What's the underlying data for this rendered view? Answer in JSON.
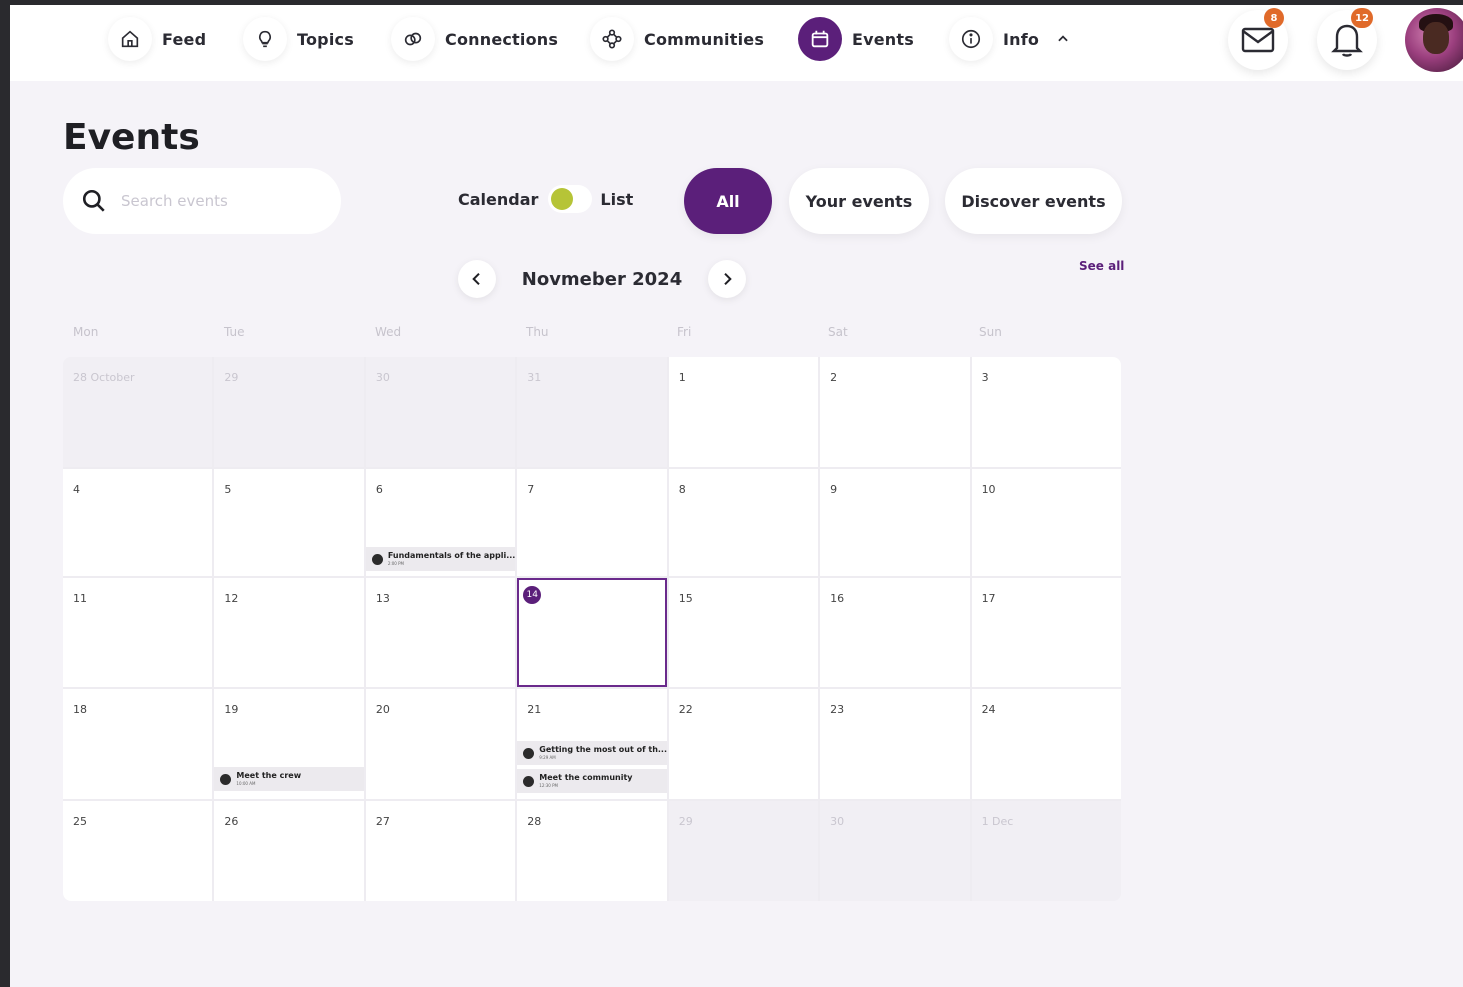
{
  "nav": {
    "items": [
      {
        "label": "Feed",
        "icon": "home-icon"
      },
      {
        "label": "Topics",
        "icon": "lightbulb-icon"
      },
      {
        "label": "Connections",
        "icon": "link-icon"
      },
      {
        "label": "Communities",
        "icon": "communities-icon"
      },
      {
        "label": "Events",
        "icon": "calendar-icon",
        "active": true
      },
      {
        "label": "Info",
        "icon": "info-icon"
      }
    ],
    "mail_badge": "8",
    "notifications_badge": "12"
  },
  "page": {
    "title": "Events",
    "search_placeholder": "Search events",
    "view_toggle": {
      "left": "Calendar",
      "right": "List"
    },
    "filters": [
      "All",
      "Your events",
      "Discover events"
    ],
    "month": "Novmeber 2024",
    "see_all": "See all"
  },
  "calendar": {
    "weekdays": [
      "Mon",
      "Tue",
      "Wed",
      "Thu",
      "Fri",
      "Sat",
      "Sun"
    ],
    "cells": [
      {
        "label": "28  October",
        "muted": true
      },
      {
        "label": "29",
        "muted": true
      },
      {
        "label": "30",
        "muted": true
      },
      {
        "label": "31",
        "muted": true
      },
      {
        "label": "1"
      },
      {
        "label": "2"
      },
      {
        "label": "3"
      },
      {
        "label": "4"
      },
      {
        "label": "5"
      },
      {
        "label": "6",
        "events": [
          {
            "title": "Fundamentals of the appli...",
            "time": "2:00 PM"
          }
        ]
      },
      {
        "label": "7"
      },
      {
        "label": "8"
      },
      {
        "label": "9"
      },
      {
        "label": "10"
      },
      {
        "label": "11"
      },
      {
        "label": "12"
      },
      {
        "label": "13"
      },
      {
        "label": "14",
        "today": true
      },
      {
        "label": "15"
      },
      {
        "label": "16"
      },
      {
        "label": "17"
      },
      {
        "label": "18"
      },
      {
        "label": "19",
        "events": [
          {
            "title": "Meet the crew",
            "time": "10:00 AM"
          }
        ]
      },
      {
        "label": "20"
      },
      {
        "label": "21",
        "events": [
          {
            "title": "Getting the most out of th...",
            "time": "9:29 AM"
          },
          {
            "title": "Meet the community",
            "time": "12:30 PM"
          }
        ]
      },
      {
        "label": "22"
      },
      {
        "label": "23"
      },
      {
        "label": "24"
      },
      {
        "label": "25"
      },
      {
        "label": "26"
      },
      {
        "label": "27"
      },
      {
        "label": "28"
      },
      {
        "label": "29",
        "muted": true
      },
      {
        "label": "30",
        "muted": true
      },
      {
        "label": "1  Dec",
        "muted": true
      }
    ]
  },
  "colors": {
    "accent": "#5b1f7a",
    "toggle": "#b6c437",
    "badge": "#e06a2a"
  }
}
